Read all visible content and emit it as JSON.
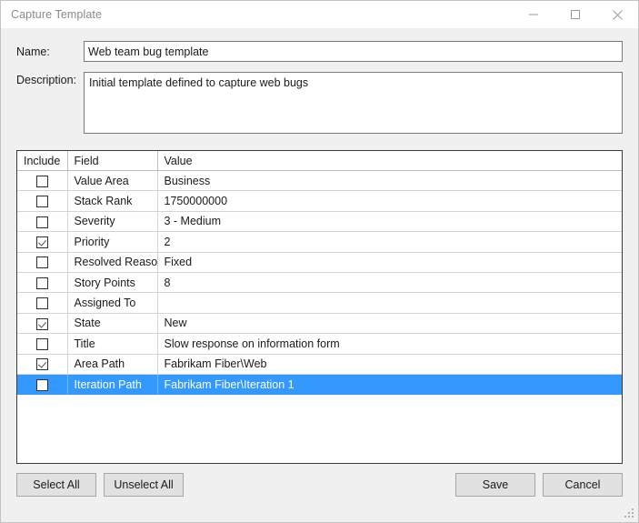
{
  "window": {
    "title": "Capture Template",
    "controls": {
      "minimize": "minimize-icon",
      "maximize": "maximize-icon",
      "close": "close-icon"
    }
  },
  "form": {
    "name_label": "Name:",
    "name_value": "Web team bug template",
    "description_label": "Description:",
    "description_value": "Initial template defined to capture web bugs"
  },
  "grid": {
    "columns": [
      "Include",
      "Field",
      "Value"
    ],
    "rows": [
      {
        "include": false,
        "field": "Value Area",
        "value": "Business",
        "selected": false
      },
      {
        "include": false,
        "field": "Stack Rank",
        "value": "1750000000",
        "selected": false
      },
      {
        "include": false,
        "field": "Severity",
        "value": "3 - Medium",
        "selected": false
      },
      {
        "include": true,
        "field": "Priority",
        "value": "2",
        "selected": false
      },
      {
        "include": false,
        "field": "Resolved Reason",
        "value": "Fixed",
        "selected": false
      },
      {
        "include": false,
        "field": "Story Points",
        "value": "8",
        "selected": false
      },
      {
        "include": false,
        "field": "Assigned To",
        "value": "",
        "selected": false
      },
      {
        "include": true,
        "field": "State",
        "value": "New",
        "selected": false
      },
      {
        "include": false,
        "field": "Title",
        "value": "Slow response on information form",
        "selected": false
      },
      {
        "include": true,
        "field": "Area Path",
        "value": "Fabrikam Fiber\\Web",
        "selected": false
      },
      {
        "include": false,
        "field": "Iteration Path",
        "value": "Fabrikam Fiber\\Iteration 1",
        "selected": true
      }
    ]
  },
  "footer": {
    "select_all": "Select All",
    "unselect_all": "Unselect All",
    "save": "Save",
    "cancel": "Cancel"
  },
  "colors": {
    "selection_blue": "#3399ff",
    "window_background": "#f0f0f0",
    "button_face": "#e1e1e1"
  }
}
